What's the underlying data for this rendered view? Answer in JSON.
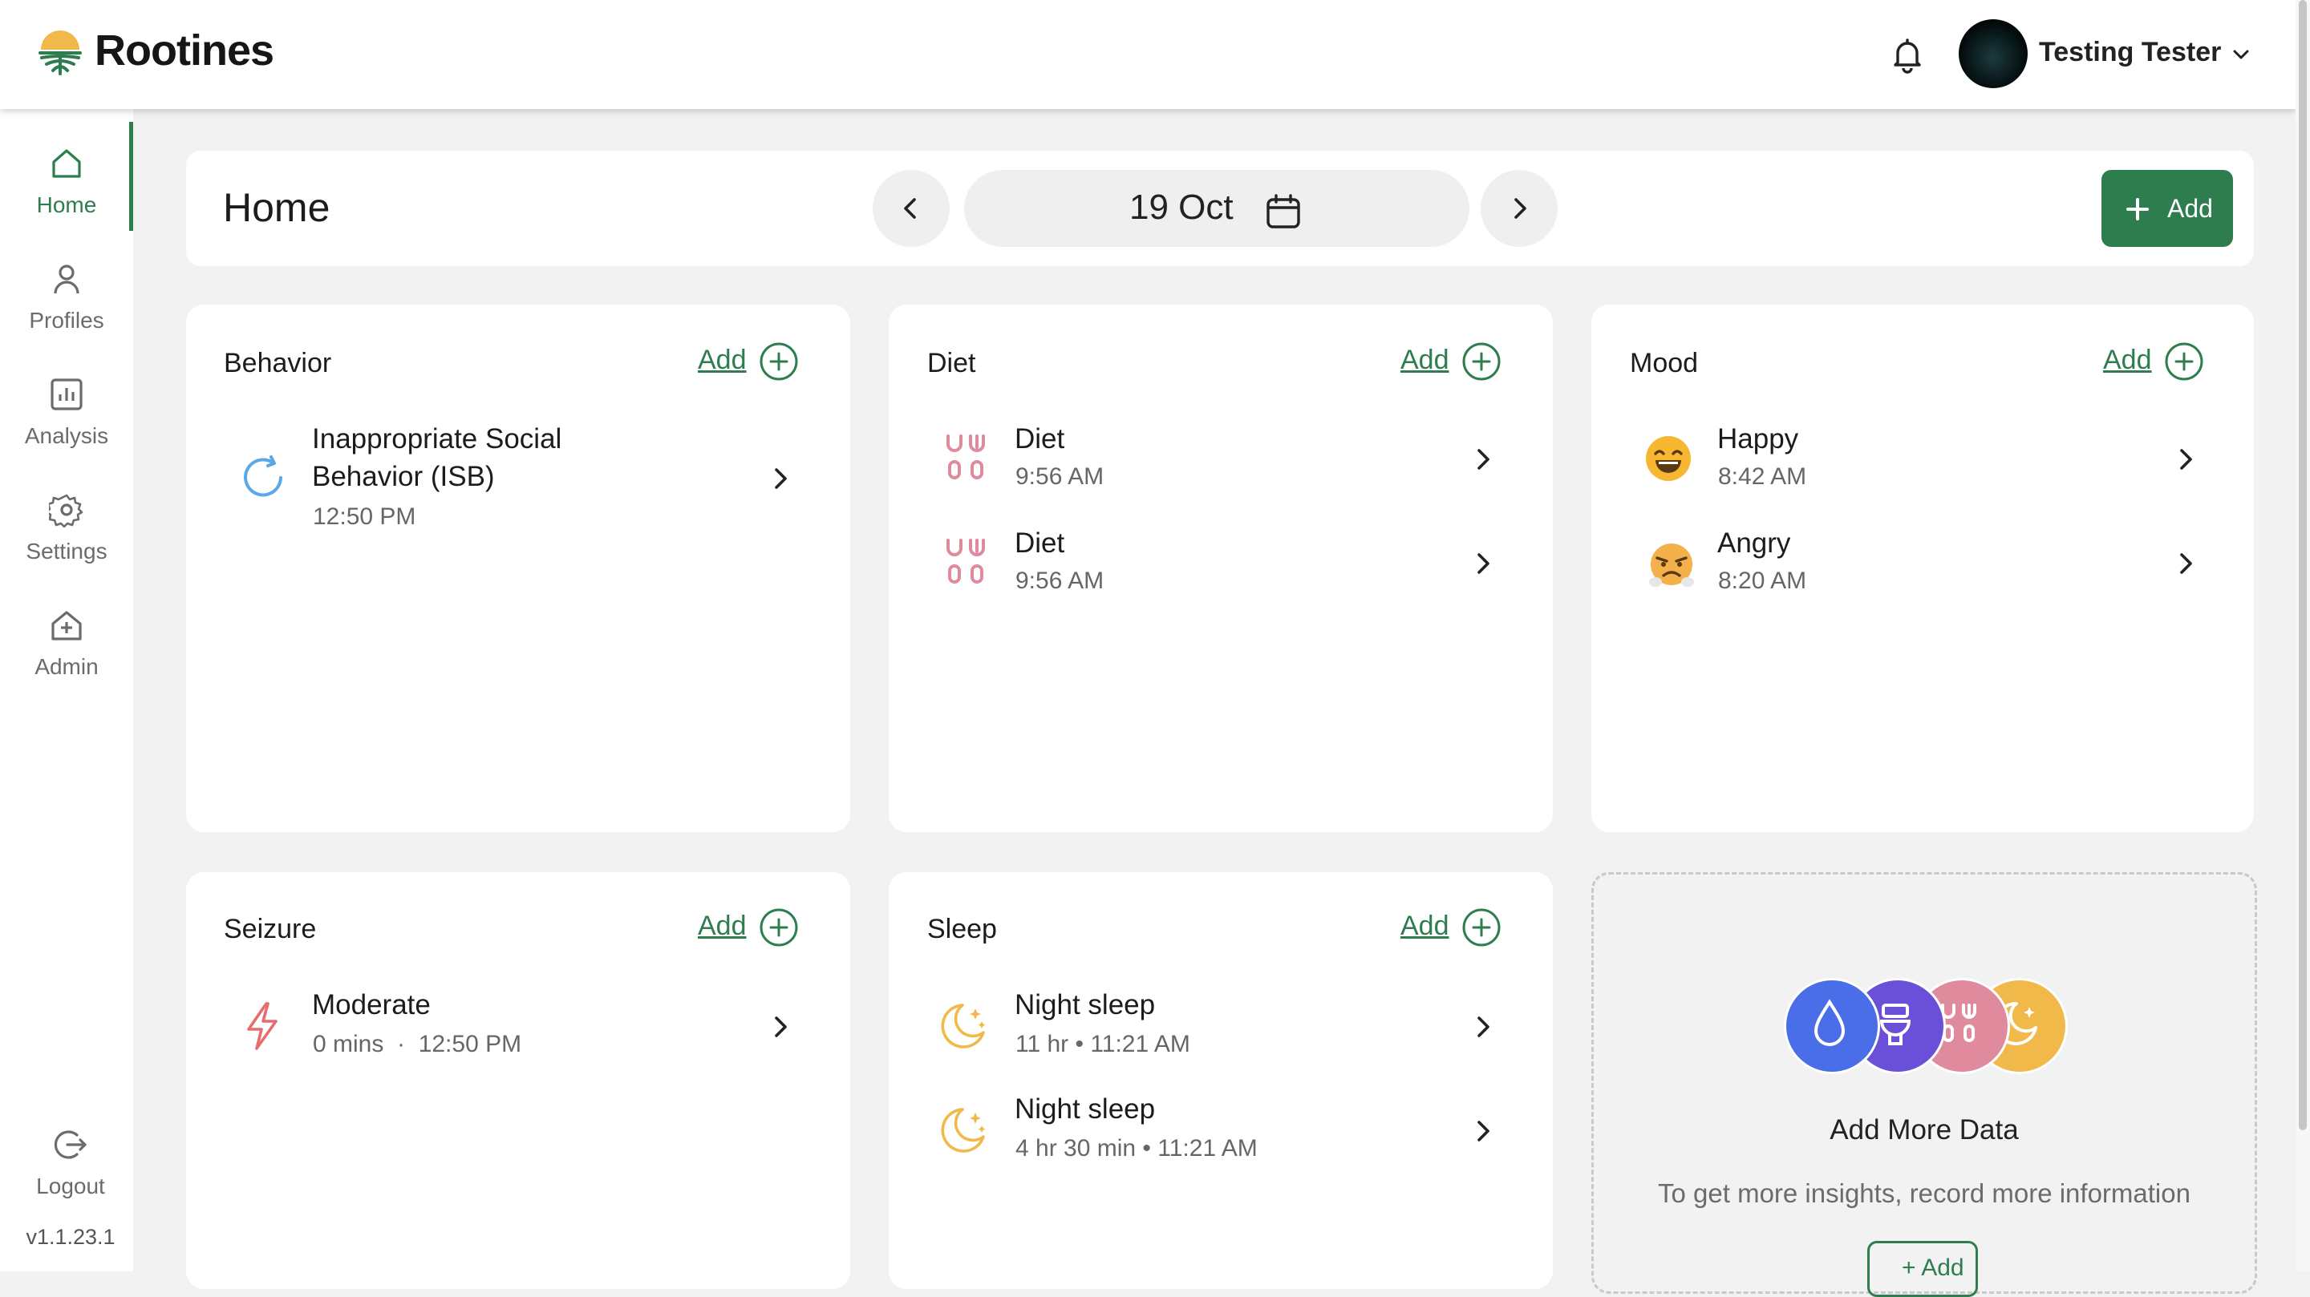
{
  "app": {
    "brand": "Rootines",
    "version": "v1.1.23.1"
  },
  "header": {
    "username": "Testing Tester"
  },
  "nav": {
    "home": "Home",
    "profiles": "Profiles",
    "analysis": "Analysis",
    "settings": "Settings",
    "admin": "Admin",
    "logout": "Logout"
  },
  "page": {
    "title": "Home",
    "date": "19 Oct",
    "add_label": "Add"
  },
  "cards": {
    "behavior": {
      "title": "Behavior",
      "add": "Add",
      "entries": [
        {
          "name": "Inappropriate Social Behavior (ISB)",
          "time": "12:50 PM"
        }
      ]
    },
    "diet": {
      "title": "Diet",
      "add": "Add",
      "entries": [
        {
          "name": "Diet",
          "time": "9:56 AM"
        },
        {
          "name": "Diet",
          "time": "9:56 AM"
        }
      ]
    },
    "mood": {
      "title": "Mood",
      "add": "Add",
      "entries": [
        {
          "name": "Happy",
          "time": "8:42 AM"
        },
        {
          "name": "Angry",
          "time": "8:20 AM"
        }
      ]
    },
    "seizure": {
      "title": "Seizure",
      "add": "Add",
      "entries": [
        {
          "name": "Moderate",
          "detail": "0 mins  ·  12:50 PM"
        }
      ]
    },
    "sleep": {
      "title": "Sleep",
      "add": "Add",
      "entries": [
        {
          "name": "Night sleep",
          "detail": "11 hr • 11:21 AM"
        },
        {
          "name": "Night sleep",
          "detail": "4 hr 30 min • 11:21 AM"
        }
      ]
    }
  },
  "add_more": {
    "title": "Add More Data",
    "subtitle": "To get more insights, record more information",
    "button": "+ Add"
  },
  "colors": {
    "brand_green": "#2e7d4f",
    "water_blue": "#4a6ee8",
    "toilet_purple": "#6a4fd8",
    "diet_pink": "#e08a9e",
    "sleep_yellow": "#f0b94a",
    "seizure_red": "#e56d6d",
    "behavior_blue": "#5aa8e8"
  }
}
